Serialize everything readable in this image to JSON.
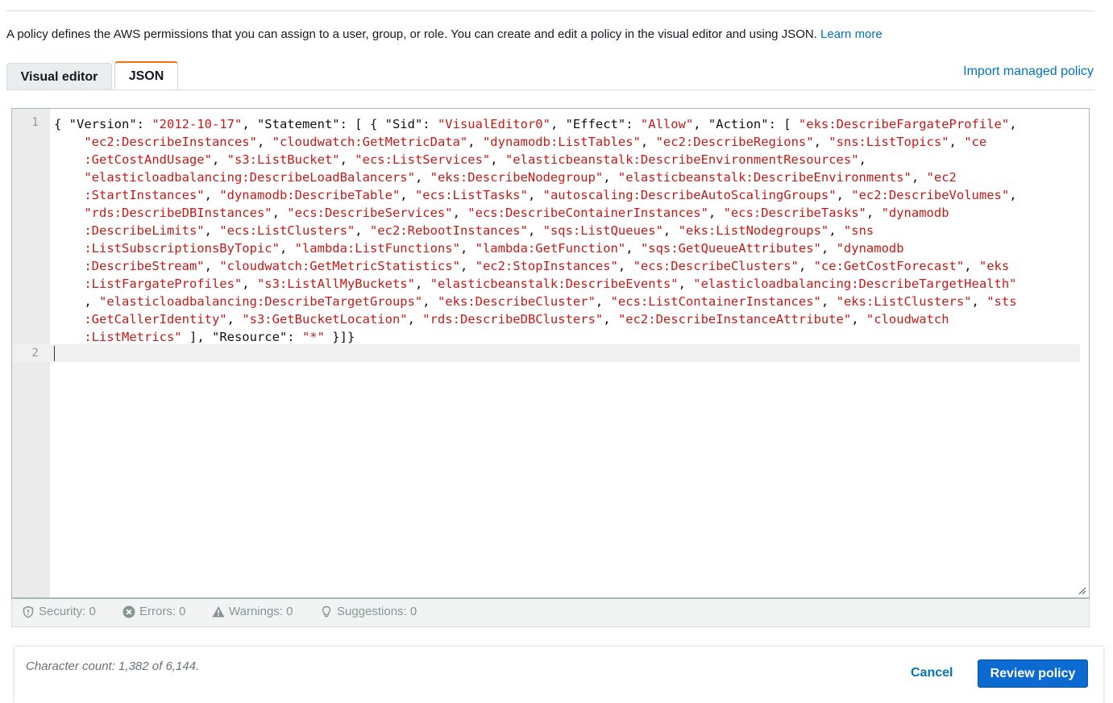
{
  "description": {
    "text": "A policy defines the AWS permissions that you can assign to a user, group, or role. You can create and edit a policy in the visual editor and using JSON.",
    "learn_more": "Learn more"
  },
  "tabs": [
    {
      "label": "Visual editor",
      "active": false
    },
    {
      "label": "JSON",
      "active": true
    }
  ],
  "import_link": "Import managed policy",
  "editor": {
    "line_numbers": [
      "1",
      "2"
    ],
    "lines": [
      [
        [
          "p",
          "{ \"Version\": "
        ],
        [
          "s",
          "\"2012-10-17\""
        ],
        [
          "p",
          ", \"Statement\": [ { \"Sid\": "
        ],
        [
          "s",
          "\"VisualEditor0\""
        ],
        [
          "p",
          ", \"Effect\": "
        ],
        [
          "s",
          "\"Allow\""
        ],
        [
          "p",
          ", \"Action\": [ "
        ],
        [
          "s",
          "\"eks:DescribeFargateProfile\""
        ],
        [
          "p",
          ","
        ]
      ],
      [
        [
          "p",
          "    "
        ],
        [
          "s",
          "\"ec2:DescribeInstances\""
        ],
        [
          "p",
          ", "
        ],
        [
          "s",
          "\"cloudwatch:GetMetricData\""
        ],
        [
          "p",
          ", "
        ],
        [
          "s",
          "\"dynamodb:ListTables\""
        ],
        [
          "p",
          ", "
        ],
        [
          "s",
          "\"ec2:DescribeRegions\""
        ],
        [
          "p",
          ", "
        ],
        [
          "s",
          "\"sns:ListTopics\""
        ],
        [
          "p",
          ", "
        ],
        [
          "s",
          "\"ce"
        ]
      ],
      [
        [
          "p",
          "    "
        ],
        [
          "s",
          ":GetCostAndUsage\""
        ],
        [
          "p",
          ", "
        ],
        [
          "s",
          "\"s3:ListBucket\""
        ],
        [
          "p",
          ", "
        ],
        [
          "s",
          "\"ecs:ListServices\""
        ],
        [
          "p",
          ", "
        ],
        [
          "s",
          "\"elasticbeanstalk:DescribeEnvironmentResources\""
        ],
        [
          "p",
          ","
        ]
      ],
      [
        [
          "p",
          "    "
        ],
        [
          "s",
          "\"elasticloadbalancing:DescribeLoadBalancers\""
        ],
        [
          "p",
          ", "
        ],
        [
          "s",
          "\"eks:DescribeNodegroup\""
        ],
        [
          "p",
          ", "
        ],
        [
          "s",
          "\"elasticbeanstalk:DescribeEnvironments\""
        ],
        [
          "p",
          ", "
        ],
        [
          "s",
          "\"ec2"
        ]
      ],
      [
        [
          "p",
          "    "
        ],
        [
          "s",
          ":StartInstances\""
        ],
        [
          "p",
          ", "
        ],
        [
          "s",
          "\"dynamodb:DescribeTable\""
        ],
        [
          "p",
          ", "
        ],
        [
          "s",
          "\"ecs:ListTasks\""
        ],
        [
          "p",
          ", "
        ],
        [
          "s",
          "\"autoscaling:DescribeAutoScalingGroups\""
        ],
        [
          "p",
          ", "
        ],
        [
          "s",
          "\"ec2:DescribeVolumes\""
        ],
        [
          "p",
          ","
        ]
      ],
      [
        [
          "p",
          "    "
        ],
        [
          "s",
          "\"rds:DescribeDBInstances\""
        ],
        [
          "p",
          ", "
        ],
        [
          "s",
          "\"ecs:DescribeServices\""
        ],
        [
          "p",
          ", "
        ],
        [
          "s",
          "\"ecs:DescribeContainerInstances\""
        ],
        [
          "p",
          ", "
        ],
        [
          "s",
          "\"ecs:DescribeTasks\""
        ],
        [
          "p",
          ", "
        ],
        [
          "s",
          "\"dynamodb"
        ]
      ],
      [
        [
          "p",
          "    "
        ],
        [
          "s",
          ":DescribeLimits\""
        ],
        [
          "p",
          ", "
        ],
        [
          "s",
          "\"ecs:ListClusters\""
        ],
        [
          "p",
          ", "
        ],
        [
          "s",
          "\"ec2:RebootInstances\""
        ],
        [
          "p",
          ", "
        ],
        [
          "s",
          "\"sqs:ListQueues\""
        ],
        [
          "p",
          ", "
        ],
        [
          "s",
          "\"eks:ListNodegroups\""
        ],
        [
          "p",
          ", "
        ],
        [
          "s",
          "\"sns"
        ]
      ],
      [
        [
          "p",
          "    "
        ],
        [
          "s",
          ":ListSubscriptionsByTopic\""
        ],
        [
          "p",
          ", "
        ],
        [
          "s",
          "\"lambda:ListFunctions\""
        ],
        [
          "p",
          ", "
        ],
        [
          "s",
          "\"lambda:GetFunction\""
        ],
        [
          "p",
          ", "
        ],
        [
          "s",
          "\"sqs:GetQueueAttributes\""
        ],
        [
          "p",
          ", "
        ],
        [
          "s",
          "\"dynamodb"
        ]
      ],
      [
        [
          "p",
          "    "
        ],
        [
          "s",
          ":DescribeStream\""
        ],
        [
          "p",
          ", "
        ],
        [
          "s",
          "\"cloudwatch:GetMetricStatistics\""
        ],
        [
          "p",
          ", "
        ],
        [
          "s",
          "\"ec2:StopInstances\""
        ],
        [
          "p",
          ", "
        ],
        [
          "s",
          "\"ecs:DescribeClusters\""
        ],
        [
          "p",
          ", "
        ],
        [
          "s",
          "\"ce:GetCostForecast\""
        ],
        [
          "p",
          ", "
        ],
        [
          "s",
          "\"eks"
        ]
      ],
      [
        [
          "p",
          "    "
        ],
        [
          "s",
          ":ListFargateProfiles\""
        ],
        [
          "p",
          ", "
        ],
        [
          "s",
          "\"s3:ListAllMyBuckets\""
        ],
        [
          "p",
          ", "
        ],
        [
          "s",
          "\"elasticbeanstalk:DescribeEvents\""
        ],
        [
          "p",
          ", "
        ],
        [
          "s",
          "\"elasticloadbalancing:DescribeTargetHealth\""
        ]
      ],
      [
        [
          "p",
          "    , "
        ],
        [
          "s",
          "\"elasticloadbalancing:DescribeTargetGroups\""
        ],
        [
          "p",
          ", "
        ],
        [
          "s",
          "\"eks:DescribeCluster\""
        ],
        [
          "p",
          ", "
        ],
        [
          "s",
          "\"ecs:ListContainerInstances\""
        ],
        [
          "p",
          ", "
        ],
        [
          "s",
          "\"eks:ListClusters\""
        ],
        [
          "p",
          ", "
        ],
        [
          "s",
          "\"sts"
        ]
      ],
      [
        [
          "p",
          "    "
        ],
        [
          "s",
          ":GetCallerIdentity\""
        ],
        [
          "p",
          ", "
        ],
        [
          "s",
          "\"s3:GetBucketLocation\""
        ],
        [
          "p",
          ", "
        ],
        [
          "s",
          "\"rds:DescribeDBClusters\""
        ],
        [
          "p",
          ", "
        ],
        [
          "s",
          "\"ec2:DescribeInstanceAttribute\""
        ],
        [
          "p",
          ", "
        ],
        [
          "s",
          "\"cloudwatch"
        ]
      ],
      [
        [
          "p",
          "    "
        ],
        [
          "s",
          ":ListMetrics\""
        ],
        [
          "p",
          " ], \"Resource\": "
        ],
        [
          "s",
          "\"*\""
        ],
        [
          "p",
          " }]}"
        ]
      ]
    ]
  },
  "status_bar": [
    {
      "icon": "shield-icon",
      "label": "Security: 0"
    },
    {
      "icon": "error-circle-icon",
      "label": "Errors: 0"
    },
    {
      "icon": "warning-triangle-icon",
      "label": "Warnings: 0"
    },
    {
      "icon": "lightbulb-icon",
      "label": "Suggestions: 0"
    }
  ],
  "footer": {
    "character_count": "Character count: 1,382 of 6,144.",
    "cancel_label": "Cancel",
    "review_label": "Review policy"
  },
  "colors": {
    "string": "#c41a16",
    "link": "#0073bb",
    "active_tab_accent": "#ec7211",
    "primary_button": "#0b6bd1"
  }
}
